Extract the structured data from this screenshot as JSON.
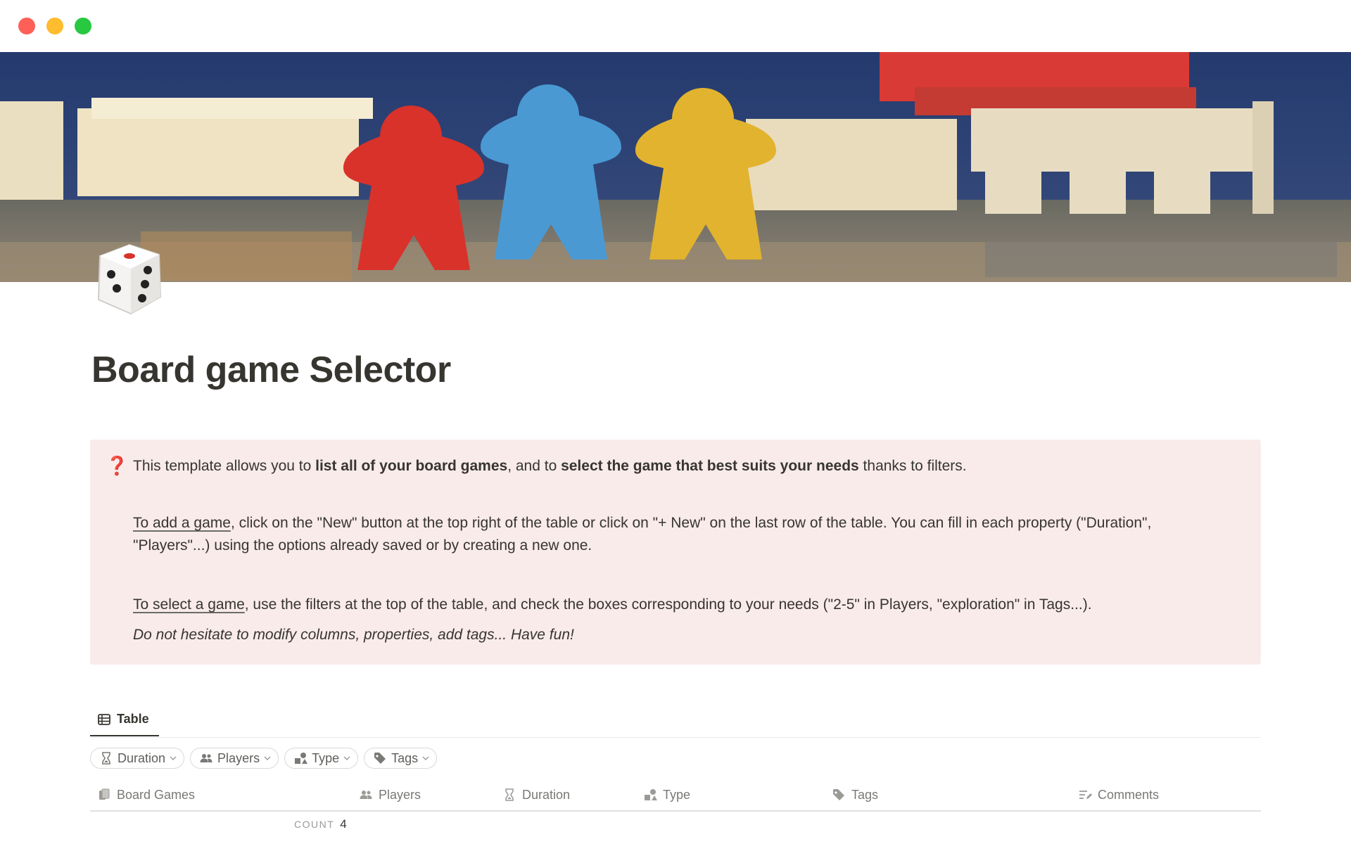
{
  "window": {
    "controls": [
      "close",
      "minimize",
      "maximize"
    ]
  },
  "cover": {
    "description_icon": "meeple-cover-image"
  },
  "page": {
    "icon": "die-icon",
    "title": "Board game Selector"
  },
  "callout": {
    "icon": "question-mark-icon",
    "color": "#f9ebea",
    "p1": {
      "t1": "This template allows you to ",
      "b1": "list all of your board games",
      "t2": ", and to ",
      "b2": "select the game that best suits your needs",
      "t3": " thanks to filters."
    },
    "p2": {
      "u": "To add a game",
      "t": ", click on the \"New\" button at the top right of the table or click on \"+ New\" on the last row of the table. You can fill in each property (\"Duration\", \"Players\"...) using the options already saved or by creating a new one."
    },
    "p3": {
      "u": "To select a game",
      "t": ", use the filters at the top of the table, and check the boxes corresponding to your needs (\"2-5\" in Players, \"exploration\" in Tags...)."
    },
    "p4": "Do not hesitate to modify columns, properties, add tags... Have fun!"
  },
  "views": {
    "active": "Table"
  },
  "filters": [
    {
      "label": "Duration",
      "icon": "hourglass-icon"
    },
    {
      "label": "Players",
      "icon": "people-icon"
    },
    {
      "label": "Type",
      "icon": "shapes-icon"
    },
    {
      "label": "Tags",
      "icon": "tag-icon"
    }
  ],
  "table": {
    "columns": [
      {
        "label": "Board Games",
        "icon": "title-icon"
      },
      {
        "label": "Players",
        "icon": "people-icon"
      },
      {
        "label": "Duration",
        "icon": "hourglass-icon"
      },
      {
        "label": "Type",
        "icon": "shapes-icon"
      },
      {
        "label": "Tags",
        "icon": "tag-icon"
      },
      {
        "label": "Comments",
        "icon": "text-icon"
      }
    ],
    "count_label": "COUNT",
    "count_value": "4"
  }
}
